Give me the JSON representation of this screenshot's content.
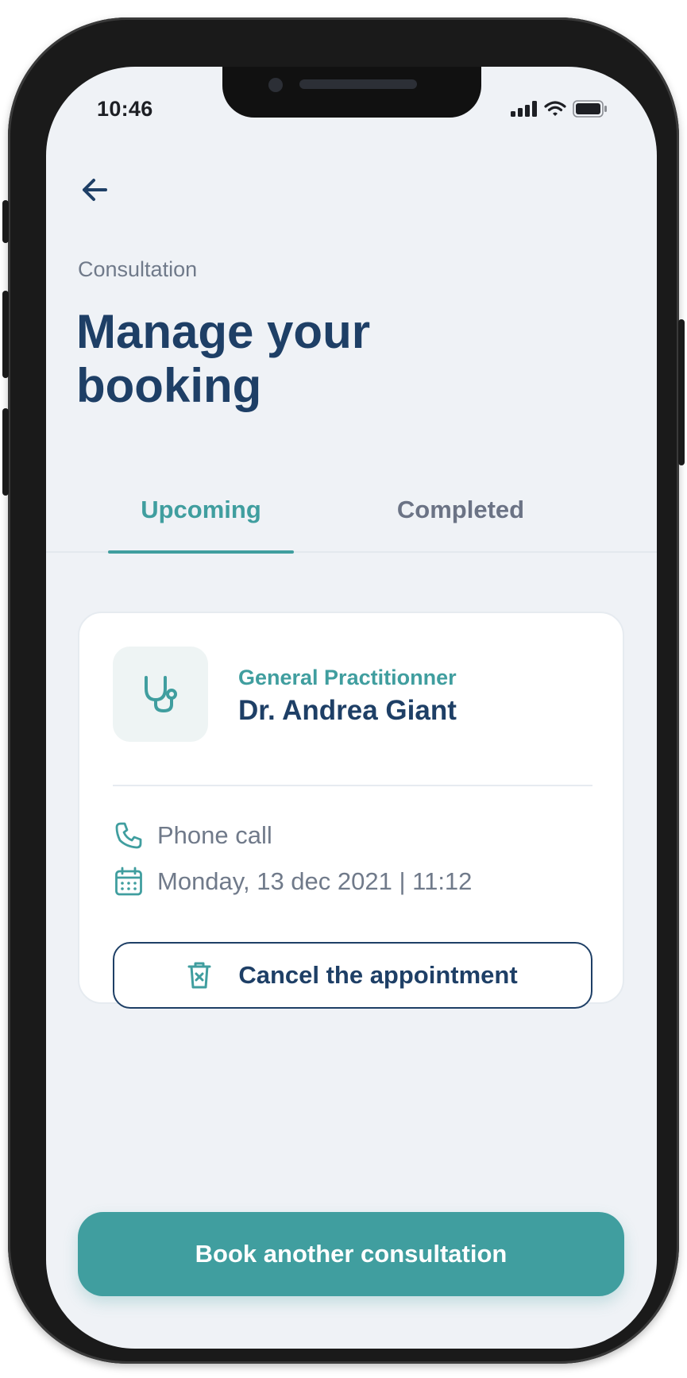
{
  "status_bar": {
    "time": "10:46",
    "icons": [
      "cellular-signal-icon",
      "wifi-icon",
      "battery-icon"
    ]
  },
  "header": {
    "back_icon": "arrow-left-icon",
    "eyebrow": "Consultation",
    "title": "Manage your booking"
  },
  "tabs": [
    {
      "label": "Upcoming",
      "active": true
    },
    {
      "label": "Completed",
      "active": false
    }
  ],
  "appointment": {
    "icon": "stethoscope-icon",
    "specialty": "General Practitionner",
    "doctor": "Dr. Andrea Giant",
    "mode_icon": "phone-icon",
    "mode": "Phone call",
    "date_icon": "calendar-icon",
    "datetime": "Monday, 13 dec 2021 | 11:12",
    "cancel_icon": "trash-icon",
    "cancel_label": "Cancel the appointment"
  },
  "footer": {
    "book_label": "Book another consultation"
  },
  "colors": {
    "primary_teal": "#409e9f",
    "navy": "#1e3f66",
    "muted_text": "#707a8a",
    "background": "#eff2f6"
  }
}
